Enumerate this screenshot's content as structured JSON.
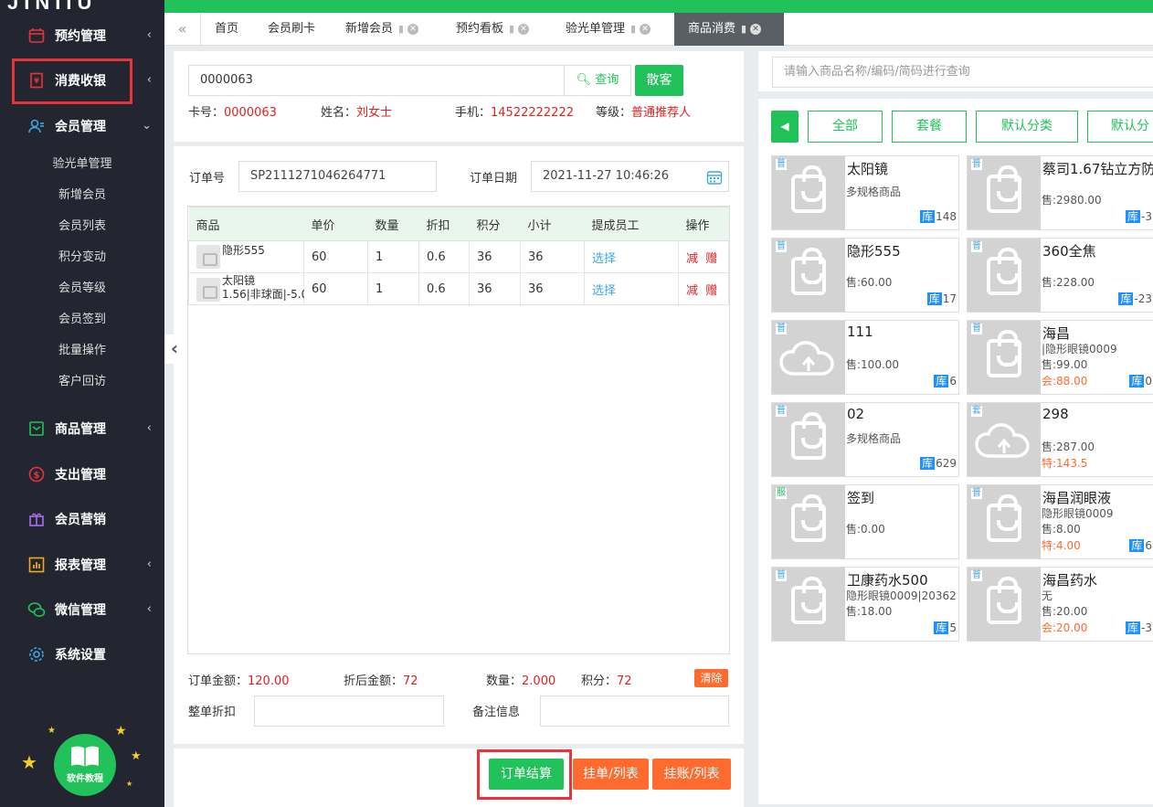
{
  "sidebar": {
    "logo": "JINIIU",
    "items": [
      {
        "label": "预约管理",
        "chev": "‹"
      },
      {
        "label": "消费收银",
        "chev": "‹"
      },
      {
        "label": "会员管理",
        "chev": "⌄"
      },
      {
        "label": "商品管理",
        "chev": "‹"
      },
      {
        "label": "支出管理",
        "chev": ""
      },
      {
        "label": "会员营销",
        "chev": ""
      },
      {
        "label": "报表管理",
        "chev": "‹"
      },
      {
        "label": "微信管理",
        "chev": "‹"
      },
      {
        "label": "系统设置",
        "chev": ""
      }
    ],
    "sub_items": [
      "验光单管理",
      "新增会员",
      "会员列表",
      "积分变动",
      "会员等级",
      "会员签到",
      "批量操作",
      "客户回访"
    ],
    "tutorial_label": "软件教程"
  },
  "tabs": {
    "back": "«",
    "items": [
      "首页",
      "会员刷卡",
      "新增会员",
      "预约看板",
      "验光单管理",
      "商品消费"
    ]
  },
  "member": {
    "card_input": "0000063",
    "query_label": "查询",
    "walkin_label": "散客",
    "card_label": "卡号：",
    "card_value": "0000063",
    "name_label": "姓名：",
    "name_value": "刘女士",
    "phone_label": "手机：",
    "phone_value": "14522222222",
    "level_label": "等级：",
    "level_value": "普通推荐人"
  },
  "order": {
    "no_label": "订单号",
    "no_value": "SP2111271046264771",
    "date_label": "订单日期",
    "date_value": "2021-11-27 10:46:26",
    "headers": [
      "商品",
      "单价",
      "数量",
      "折扣",
      "积分",
      "小计",
      "提成员工",
      "操作"
    ],
    "rows": [
      {
        "name": "隐形555",
        "sub": "",
        "price": "60",
        "qty": "1",
        "discount": "0.6",
        "points": "36",
        "subtotal": "36",
        "staff": "选择",
        "minus": "减",
        "gift": "赠"
      },
      {
        "name": "太阳镜",
        "sub": "1.56|非球面|-5.0",
        "price": "60",
        "qty": "1",
        "discount": "0.6",
        "points": "36",
        "subtotal": "36",
        "staff": "选择",
        "minus": "减",
        "gift": "赠"
      }
    ],
    "total_label": "订单金额：",
    "total_value": "120.00",
    "after_label": "折后金额：",
    "after_value": "72",
    "qty_label": "数量：",
    "qty_value": "2.000",
    "points_label": "积分：",
    "points_value": "72",
    "clear_label": "清除",
    "whole_discount_label": "整单折扣",
    "remark_label": "备注信息"
  },
  "actions": {
    "checkout": "订单结算",
    "hold": "挂单/列表",
    "credit": "挂账/列表"
  },
  "products": {
    "search_placeholder": "请输入商品名称/编码/简码进行查询",
    "categories": [
      "全部",
      "套餐",
      "默认分类",
      "默认分"
    ],
    "cards": [
      {
        "tag": "普",
        "name": "太阳镜",
        "line1": "多规格商品",
        "line2": "",
        "line3": "",
        "stock_label": "库",
        "stock": "148",
        "img": "bag"
      },
      {
        "tag": "普",
        "name": "蔡司1.67钻立方防",
        "line1": "",
        "line2": "售:2980.00",
        "line3": "",
        "stock_label": "库",
        "stock": "-3",
        "img": "bag"
      },
      {
        "tag": "普",
        "name": "隐形555",
        "line1": "",
        "line2": "售:60.00",
        "line3": "",
        "stock_label": "库",
        "stock": "17",
        "img": "bag"
      },
      {
        "tag": "普",
        "name": "360全焦",
        "line1": "",
        "line2": "售:228.00",
        "line3": "",
        "stock_label": "库",
        "stock": "-23",
        "img": "bag"
      },
      {
        "tag": "普",
        "name": "111",
        "line1": "",
        "line2": "售:100.00",
        "line3": "",
        "stock_label": "库",
        "stock": "6",
        "img": "cloud"
      },
      {
        "tag": "普",
        "name": "海昌",
        "line1": "|隐形眼镜0009",
        "line2": "售:99.00",
        "line3": "会:88.00",
        "stock_label": "库",
        "stock": "0",
        "img": "bag"
      },
      {
        "tag": "普",
        "name": "02",
        "line1": "多规格商品",
        "line2": "",
        "line3": "",
        "stock_label": "库",
        "stock": "629",
        "img": "bag"
      },
      {
        "tag": "套",
        "name": "298",
        "line1": "",
        "line2": "售:287.00",
        "line3": "特:143.5",
        "stock_label": "",
        "stock": "",
        "img": "cloud"
      },
      {
        "tag": "服",
        "name": "签到",
        "line1": "",
        "line2": "售:0.00",
        "line3": "",
        "stock_label": "",
        "stock": "",
        "img": "bag"
      },
      {
        "tag": "普",
        "name": "海昌润眼液",
        "line1": "隐形眼镜0009",
        "line2": "售:8.00",
        "line3": "特:4.00",
        "stock_label": "库",
        "stock": "6",
        "img": "bag"
      },
      {
        "tag": "普",
        "name": "卫康药水500",
        "line1": "隐形眼镜0009|20362",
        "line2": "售:18.00",
        "line3": "",
        "stock_label": "库",
        "stock": "5",
        "img": "bag"
      },
      {
        "tag": "普",
        "name": "海昌药水",
        "line1": "无",
        "line2": "售:20.00",
        "line3": "会:20.00",
        "stock_label": "库",
        "stock": "-3",
        "img": "bag"
      }
    ]
  },
  "colors": {
    "accent": "#21c25a",
    "sidebar": "#232630",
    "danger": "#e02020",
    "warn": "#ff6a2f",
    "link": "#3ea8e0"
  }
}
